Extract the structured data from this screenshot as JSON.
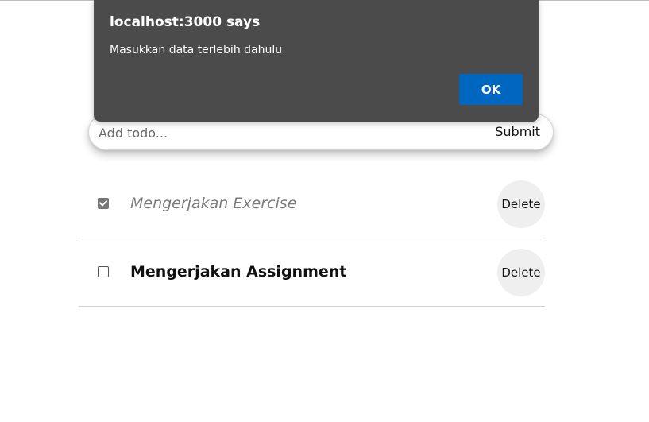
{
  "form": {
    "placeholder": "Add todo...",
    "value": "",
    "submit_label": "Submit"
  },
  "todos": [
    {
      "text": "Mengerjakan Exercise",
      "completed": true,
      "delete_label": "Delete"
    },
    {
      "text": "Mengerjakan Assignment",
      "completed": false,
      "delete_label": "Delete"
    }
  ],
  "alert": {
    "title": "localhost:3000 says",
    "message": "Masukkan data terlebih dahulu",
    "ok_label": "OK"
  },
  "colors": {
    "dialog_bg": "#4b4b4b",
    "ok_button": "#0067c0",
    "completed_text": "#7a7a7a",
    "delete_button_bg": "#efefef"
  },
  "icons": {
    "checked": "checkbox-checked-icon",
    "unchecked": "checkbox-unchecked-icon"
  }
}
